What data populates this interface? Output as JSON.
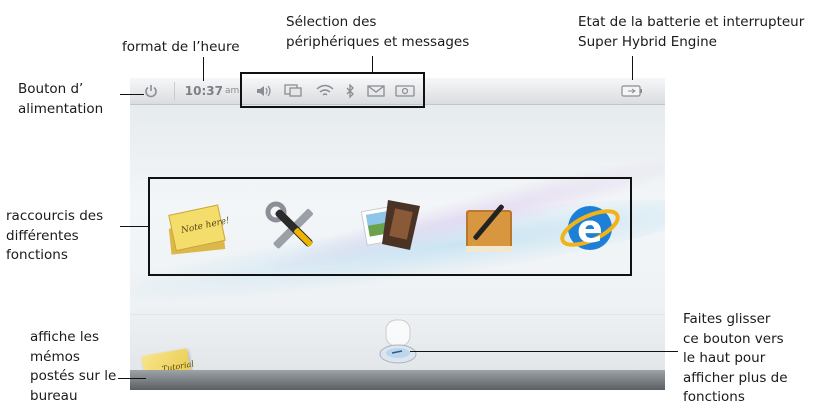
{
  "callouts": {
    "time_format": "format de l’heure",
    "devices_line1": "Sélection des",
    "devices_line2": "périphériques et messages",
    "battery_line1": "Etat de la batterie et interrupteur",
    "battery_line2": "Super Hybrid Engine",
    "power_line1": "Bouton d’",
    "power_line2": "alimentation",
    "shortcuts_line1": "raccourcis des",
    "shortcuts_line2": "différentes",
    "shortcuts_line3": "fonctions",
    "memo_line1": "affiche les",
    "memo_line2": "mémos",
    "memo_line3": "postés sur le",
    "memo_line4": "bureau",
    "drawer_line1": "Faites glisser",
    "drawer_line2": "ce bouton vers",
    "drawer_line3": "le haut pour",
    "drawer_line4": "afficher plus de",
    "drawer_line5": "fonctions"
  },
  "statusbar": {
    "time": "10:37",
    "ampm": "am",
    "icons": [
      "volume-icon",
      "display-icon",
      "wifi-icon",
      "bluetooth-icon",
      "mail-icon",
      "camera-icon"
    ],
    "battery_icon": "battery-icon",
    "power_icon": "power-icon"
  },
  "apps": [
    {
      "name": "memo-app-icon",
      "sticky_text": "Note here!"
    },
    {
      "name": "settings-tools-icon"
    },
    {
      "name": "photo-film-icon"
    },
    {
      "name": "book-pen-icon"
    },
    {
      "name": "internet-explorer-icon",
      "letter": "e"
    }
  ],
  "memo_widget_text": "Tutorial",
  "colors": {
    "accent_blue": "#1e7fd6",
    "sticky_yellow": "#f3d65f"
  }
}
